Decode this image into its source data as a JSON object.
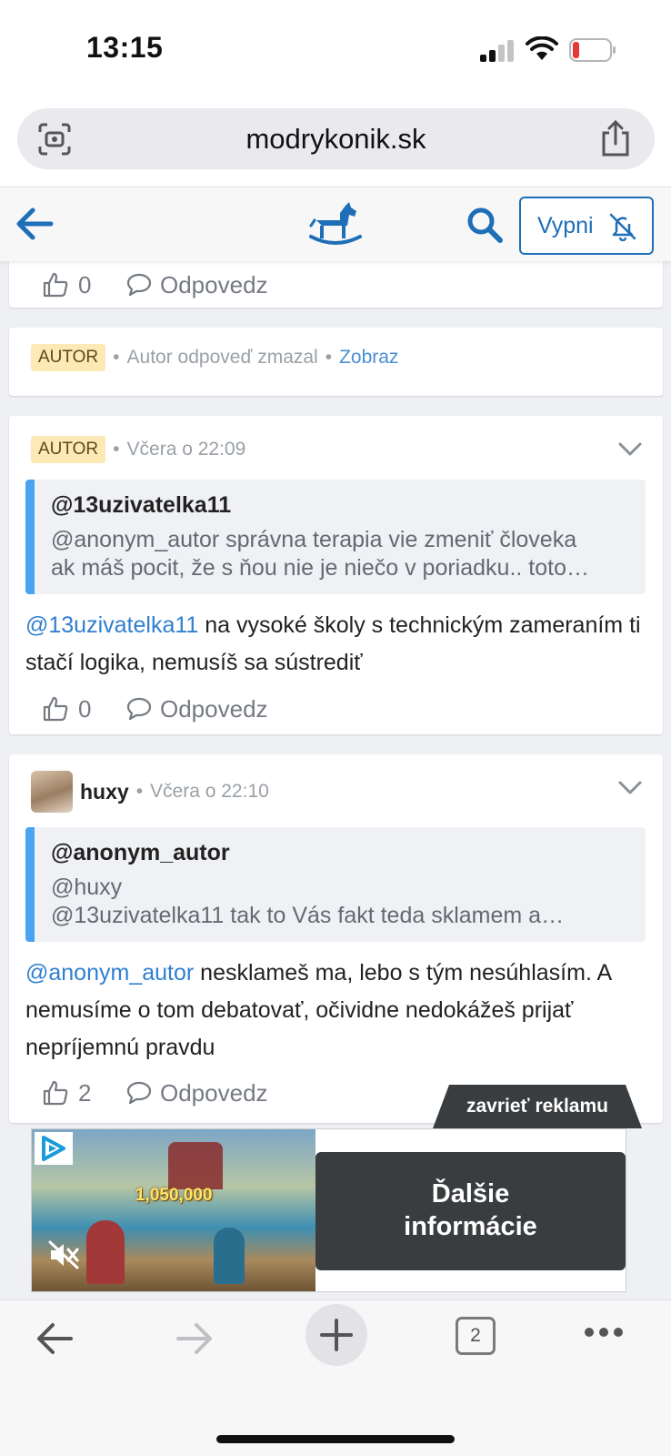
{
  "status_bar": {
    "time": "13:15"
  },
  "browser": {
    "url": "modrykonik.sk",
    "open_tabs": "2"
  },
  "site_header": {
    "notify_button_label": "Vypni"
  },
  "colors": {
    "accent": "#1e6fb8",
    "mention": "#2f7fd0",
    "quote_border": "#4aa3f0",
    "badge_bg": "#fde9b5"
  },
  "cards": [
    {
      "likes": "0",
      "reply_label": "Odpovedz"
    },
    {
      "badge": "AUTOR",
      "deleted_text": "Autor odpoveď zmazal",
      "show_link": "Zobraz"
    },
    {
      "badge": "AUTOR",
      "time": "Včera o 22:09",
      "quote_user": "@13uzivatelka11",
      "quote_line1": "@anonym_autor správna terapia vie zmeniť človeka",
      "quote_line2": "ak máš pocit, že s ňou nie je niečo v poriadku.. toto…",
      "mention": "@13uzivatelka11",
      "text": " na vysoké školy s technickým zameraním ti stačí logika, nemusíš sa sústrediť",
      "likes": "0",
      "reply_label": "Odpovedz"
    },
    {
      "username": "huxy",
      "time": "Včera o 22:10",
      "quote_user": "@anonym_autor",
      "quote_line1": "@huxy",
      "quote_line2": "@13uzivatelka11 tak to Vás fakt teda sklamem a…",
      "mention": "@anonym_autor",
      "text": " nesklameš ma, lebo s tým nesúhlasím. A nemusíme o tom debatovať, očividne nedokážeš prijať nepríjemnú pravdu",
      "likes": "2",
      "reply_label": "Odpovedz"
    }
  ],
  "ad": {
    "close_label": "zavrieť reklamu",
    "amount": "1,050,000",
    "cta_line1": "Ďalšie",
    "cta_line2": "informácie"
  }
}
